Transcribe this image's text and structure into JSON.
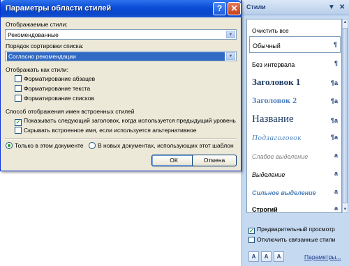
{
  "dialog": {
    "title": "Параметры области стилей",
    "help_glyph": "?",
    "close_glyph": "✕",
    "displayed_styles_label": "Отображаемые стили:",
    "displayed_styles_value": "Рекомендованные",
    "sort_order_label": "Порядок сортировки списка:",
    "sort_order_value": "Согласно рекомендации",
    "show_as_styles_label": "Отображать как стили:",
    "format_checks": [
      {
        "label": "Форматирование абзацев",
        "checked": false
      },
      {
        "label": "Форматирование текста",
        "checked": false
      },
      {
        "label": "Форматирование списков",
        "checked": false
      }
    ],
    "builtin_names_label": "Способ отображения имен встроенных стилей",
    "builtin_checks": [
      {
        "label": "Показывать следующий заголовок, когда используется предыдущий уровень",
        "checked": true
      },
      {
        "label": "Скрывать встроенное имя, если используется альтернативное",
        "checked": false
      }
    ],
    "radio_only_doc": "Только в этом документе",
    "radio_new_docs": "В новых документах, использующих этот шаблон",
    "ok_label": "ОК",
    "cancel_label": "Отмена"
  },
  "pane": {
    "title": "Стили",
    "dropdown_glyph": "▼",
    "close_glyph": "✕",
    "styles": [
      {
        "name": "Очистить все",
        "marker": ""
      },
      {
        "name": "Обычный",
        "marker": "¶"
      },
      {
        "name": "Без интервала",
        "marker": "¶"
      },
      {
        "name": "Заголовок 1",
        "marker": "¶a"
      },
      {
        "name": "Заголовок 2",
        "marker": "¶a"
      },
      {
        "name": "Название",
        "marker": "¶a"
      },
      {
        "name": "Подзаголовок",
        "marker": "¶a"
      },
      {
        "name": "Слабое выделение",
        "marker": "a"
      },
      {
        "name": "Выделение",
        "marker": "a"
      },
      {
        "name": "Сильное выделение",
        "marker": "a"
      },
      {
        "name": "Строгий",
        "marker": "a"
      }
    ],
    "preview_label": "Предварительный просмотр",
    "preview_checked": true,
    "disable_linked_label": "Отключить связанные стили",
    "disable_linked_checked": false,
    "icon_new_style": "A",
    "icon_inspector": "A",
    "icon_manage": "A",
    "options_link": "Параметры..."
  }
}
